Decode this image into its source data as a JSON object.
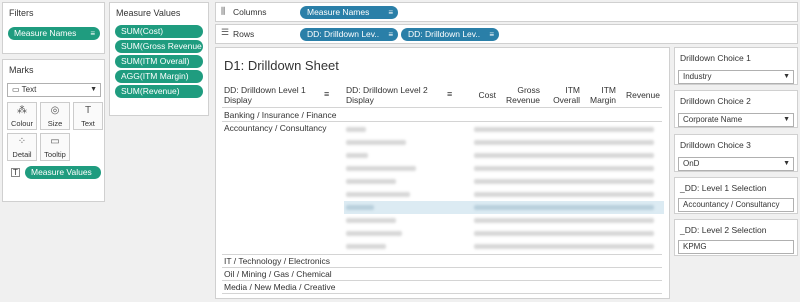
{
  "filters": {
    "title": "Filters",
    "pill": "Measure Names"
  },
  "marks": {
    "title": "Marks",
    "type": "Text",
    "buttons": [
      "Colour",
      "Size",
      "Text",
      "Detail",
      "Tooltip"
    ],
    "pill": "Measure Values"
  },
  "measure_values": {
    "title": "Measure Values",
    "pills": [
      "SUM(Cost)",
      "SUM(Gross Revenue)",
      "SUM(ITM Overall)",
      "AGG(ITM Margin)",
      "SUM(Revenue)"
    ]
  },
  "shelves": {
    "columns_label": "Columns",
    "columns_pill": "Measure Names",
    "rows_label": "Rows",
    "rows_pills": [
      "DD: Drilldown Lev..",
      "DD: Drilldown Lev.."
    ]
  },
  "sheet": {
    "title": "D1: Drilldown Sheet",
    "headers": {
      "level1": "DD: Drilldown Level 1 Display",
      "level2": "DD: Drilldown Level 2 Display",
      "cols": [
        "Cost",
        "Gross Revenue",
        "ITM Overall",
        "ITM Margin",
        "Revenue"
      ]
    },
    "rows": [
      "Banking / Insurance / Finance",
      "Accountancy / Consultancy",
      "IT / Technology / Electronics",
      "Oil / Mining / Gas / Chemical",
      "Media / New Media / Creative"
    ]
  },
  "params": [
    {
      "label": "Drilldown Choice 1",
      "value": "Industry"
    },
    {
      "label": "Drilldown Choice 2",
      "value": "Corporate Name"
    },
    {
      "label": "Drilldown Choice 3",
      "value": "OnD"
    },
    {
      "label": "_DD: Level 1 Selection",
      "value": "Accountancy / Consultancy"
    },
    {
      "label": "_DD: Level 2 Selection",
      "value": "KPMG"
    }
  ],
  "colors": {
    "pill_green": "#1f9c7f",
    "pill_blue": "#2a7fa8",
    "highlight": "#dcebf3"
  }
}
